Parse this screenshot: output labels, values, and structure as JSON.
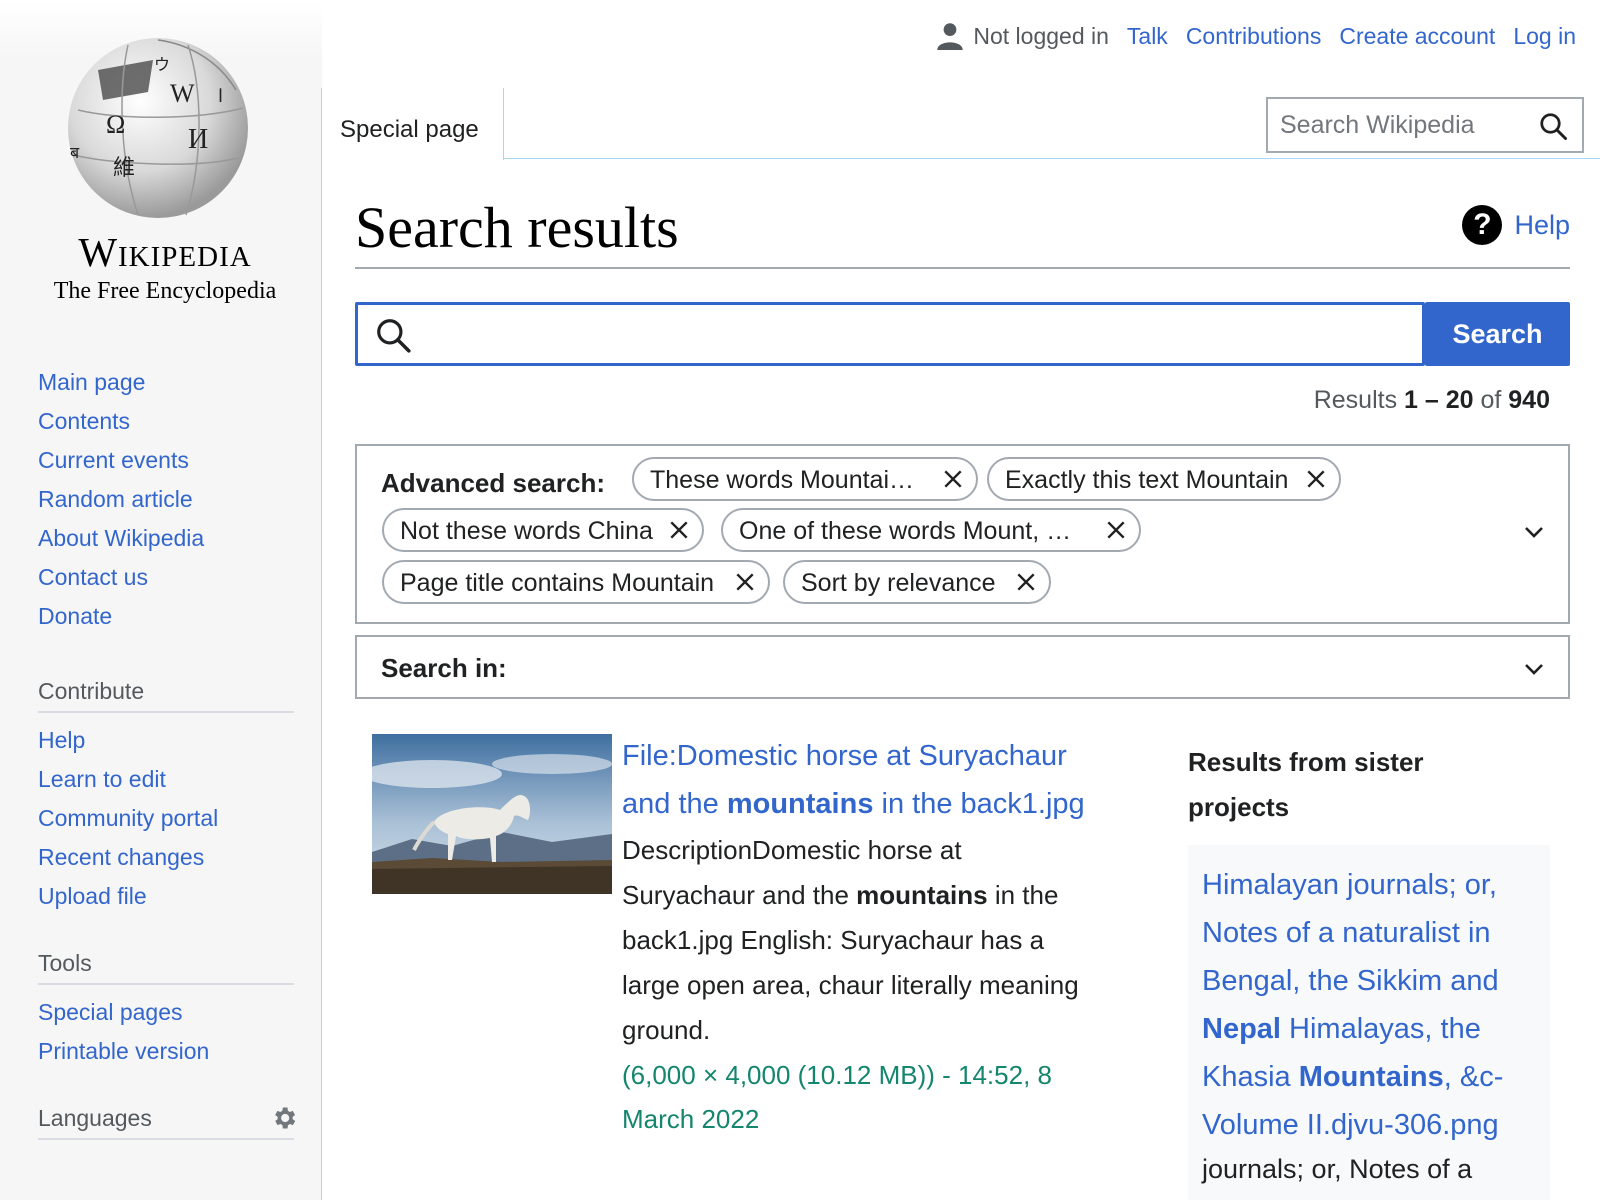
{
  "logo": {
    "wordmark": "Wikipedia",
    "tagline": "The Free Encyclopedia",
    "globe_glyphs": [
      "W",
      "Ω",
      "И",
      "維",
      "ウ",
      "ब",
      "ا"
    ]
  },
  "sidebar": {
    "navigation": [
      "Main page",
      "Contents",
      "Current events",
      "Random article",
      "About Wikipedia",
      "Contact us",
      "Donate"
    ],
    "contribute_heading": "Contribute",
    "contribute": [
      "Help",
      "Learn to edit",
      "Community portal",
      "Recent changes",
      "Upload file"
    ],
    "tools_heading": "Tools",
    "tools": [
      "Special pages",
      "Printable version"
    ],
    "languages_heading": "Languages"
  },
  "header": {
    "not_logged_in": "Not logged in",
    "links": [
      "Talk",
      "Contributions",
      "Create account",
      "Log in"
    ],
    "tab": "Special page",
    "search_placeholder": "Search Wikipedia"
  },
  "page": {
    "title": "Search results",
    "help": "Help",
    "search_value": "",
    "search_button": "Search",
    "results_prefix": "Results ",
    "results_range": "1 – 20",
    "results_of": " of ",
    "results_total": "940"
  },
  "advanced": {
    "label": "Advanced search:",
    "chips": [
      "These words Mountai…",
      "Exactly this text Mountain",
      "Not these words China",
      "One of these words Mount, …",
      "Page title contains Mountain",
      "Sort by relevance"
    ]
  },
  "search_in": {
    "label": "Search in:"
  },
  "result": {
    "title_1": "File:Domestic horse at Suryachaur and the ",
    "title_bold": "mountains",
    "title_2": " in the back1.jpg",
    "snippet_1": "DescriptionDomestic horse at Suryachaur and the ",
    "snippet_bold": "mountains",
    "snippet_2": " in the back1.jpg English: Suryachaur has a large open area, chaur literally meaning ground.",
    "meta": "(6,000 × 4,000 (10.12 MB)) - 14:52, 8 March 2022"
  },
  "sister": {
    "heading": "Results from sister projects",
    "link_1": "Himalayan journals; or, Notes of a naturalist in Bengal, the Sikkim and ",
    "link_bold_1": "Nepal",
    "link_2": " Himalayas, the Khasia ",
    "link_bold_2": "Mountains",
    "link_3": ", &c- Volume II.djvu-306.png",
    "snippet": "journals; or, Notes of a"
  },
  "colors": {
    "link": "#3366cc",
    "meta_green": "#14866d",
    "accent_button": "#3366cc"
  }
}
